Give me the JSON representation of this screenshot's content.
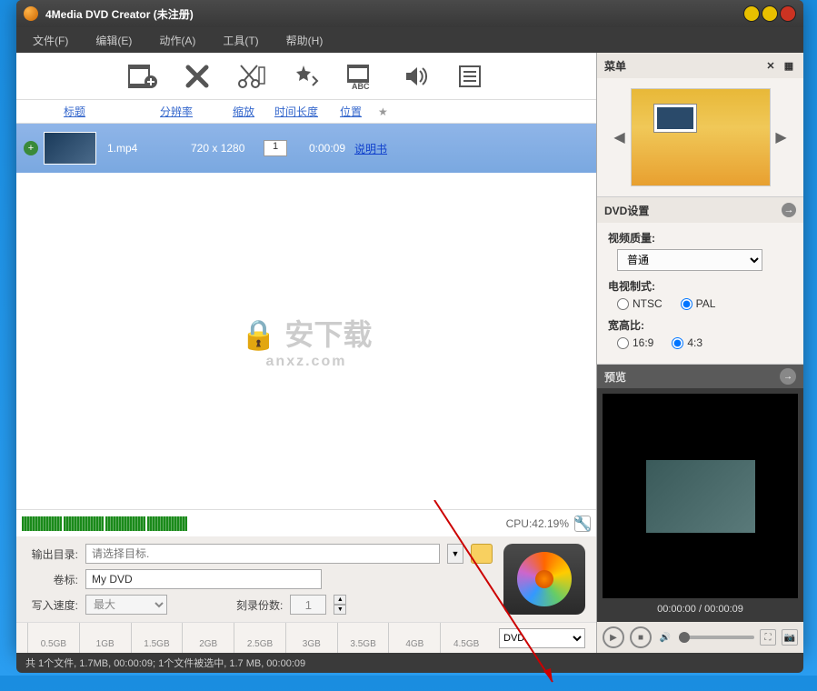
{
  "title": "4Media DVD Creator (未注册)",
  "menubar": {
    "file": "文件(F)",
    "edit": "编辑(E)",
    "action": "动作(A)",
    "tools": "工具(T)",
    "help": "帮助(H)"
  },
  "columns": {
    "title": "标题",
    "resolution": "分辨率",
    "zoom": "缩放",
    "duration": "时间长度",
    "position": "位置",
    "star": "★"
  },
  "file": {
    "name": "1.mp4",
    "resolution": "720 x 1280",
    "zoom": "1",
    "duration": "0:00:09",
    "manual": "说明书"
  },
  "watermark": {
    "main": "安下载",
    "sub": "anxz.com"
  },
  "cpu": {
    "text": "CPU:42.19%"
  },
  "output": {
    "dir_label": "输出目录:",
    "dir_placeholder": "请选择目标.",
    "vol_label": "卷标:",
    "vol_value": "My DVD",
    "speed_label": "写入速度:",
    "speed_value": "最大",
    "copies_label": "刻录份数:",
    "copies_value": "1"
  },
  "ruler": {
    "marks": [
      "0.5GB",
      "1GB",
      "1.5GB",
      "2GB",
      "2.5GB",
      "3GB",
      "3.5GB",
      "4GB",
      "4.5GB"
    ],
    "disc_type": "DVD"
  },
  "statusbar": "共 1个文件,  1.7MB,   00:00:09; 1个文件被选中, 1.7 MB,   00:00:09",
  "menu_panel": {
    "title": "菜单"
  },
  "dvd_settings": {
    "title": "DVD设置",
    "quality_label": "视频质量:",
    "quality_value": "普通",
    "tv_label": "电视制式:",
    "tv_ntsc": "NTSC",
    "tv_pal": "PAL",
    "aspect_label": "宽高比:",
    "aspect_169": "16:9",
    "aspect_43": "4:3"
  },
  "preview_panel": {
    "title": "预览",
    "time": "00:00:00 / 00:00:09"
  }
}
